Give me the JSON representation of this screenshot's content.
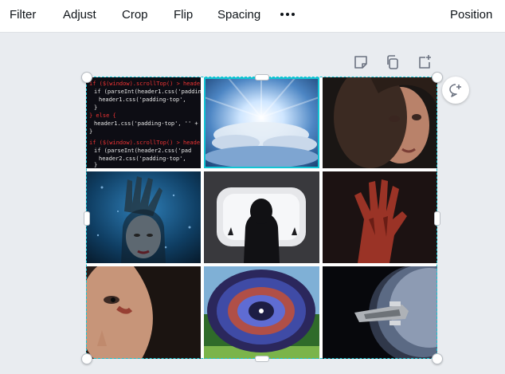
{
  "toolbar": {
    "filter": "Filter",
    "adjust": "Adjust",
    "crop": "Crop",
    "flip": "Flip",
    "spacing": "Spacing",
    "more_icon": "more-horizontal-icon",
    "position": "Position"
  },
  "canvas_actions": {
    "note_icon": "sticky-note-icon",
    "duplicate_icon": "duplicate-icon",
    "add_page_icon": "add-page-icon",
    "comment_icon": "add-comment-icon"
  },
  "grid": {
    "rows": 3,
    "columns": 3,
    "selected_cell": 1,
    "cells": [
      {
        "subject": "code-screen-photo"
      },
      {
        "subject": "clouds-light-photo"
      },
      {
        "subject": "woman-portrait-photo"
      },
      {
        "subject": "underwater-hand-face-photo"
      },
      {
        "subject": "figure-at-window-photo"
      },
      {
        "subject": "bloody-hand-photo"
      },
      {
        "subject": "wounded-face-photo"
      },
      {
        "subject": "nebula-eye-photo"
      },
      {
        "subject": "spaceship-planet-photo"
      }
    ]
  },
  "colors": {
    "selection": "#13c4d3",
    "canvas_bg": "#e9ecf0",
    "toolbar_bg": "#ffffff",
    "text": "#0e1318"
  }
}
